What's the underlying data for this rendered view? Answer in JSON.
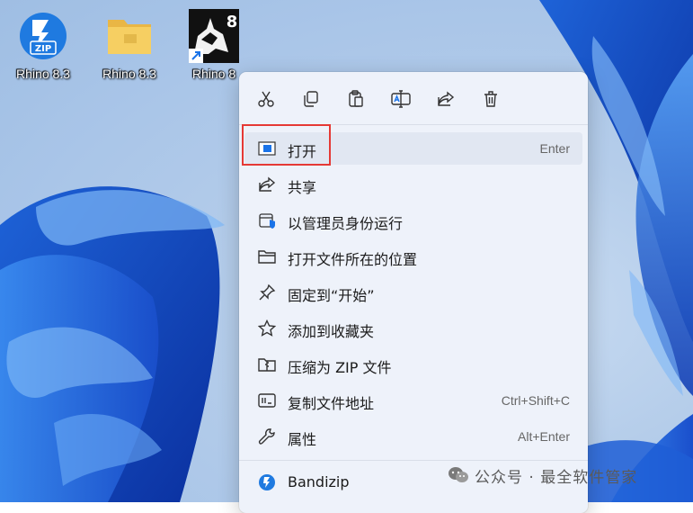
{
  "desktop": {
    "icons": [
      {
        "label": "Rhino 8.3",
        "badge": "ZIP"
      },
      {
        "label": "Rhino 8.3"
      },
      {
        "label": "Rhino 8",
        "version_mark": "8"
      }
    ]
  },
  "context_menu": {
    "toolbar": [
      "cut-icon",
      "copy-icon",
      "paste-icon",
      "rename-icon",
      "share-icon",
      "delete-icon"
    ],
    "items": [
      {
        "label": "打开",
        "shortcut": "Enter",
        "icon": "open-window-icon"
      },
      {
        "label": "共享",
        "icon": "share-icon"
      },
      {
        "label": "以管理员身份运行",
        "icon": "admin-shield-icon"
      },
      {
        "label": "打开文件所在的位置",
        "icon": "folder-icon"
      },
      {
        "label": "固定到“开始”",
        "icon": "pin-icon"
      },
      {
        "label": "添加到收藏夹",
        "icon": "star-icon"
      },
      {
        "label": "压缩为 ZIP 文件",
        "icon": "zip-folder-icon"
      },
      {
        "label": "复制文件地址",
        "shortcut": "Ctrl+Shift+C",
        "icon": "copy-path-icon"
      },
      {
        "label": "属性",
        "shortcut": "Alt+Enter",
        "icon": "wrench-icon"
      },
      {
        "label": "Bandizip",
        "icon": "bandizip-icon"
      }
    ]
  },
  "watermark": {
    "text": "公众号 · 最全软件管家"
  },
  "colors": {
    "highlight": "#e53935",
    "accent": "#1a73e8"
  }
}
